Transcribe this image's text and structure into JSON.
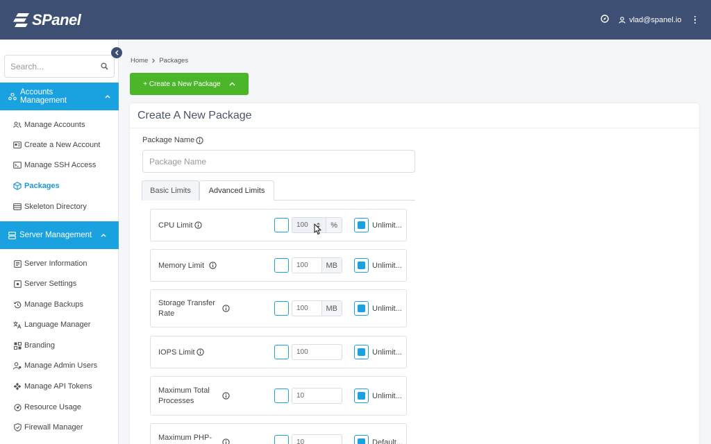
{
  "brand": {
    "name": "SPanel"
  },
  "topbar": {
    "user_email": "vlad@spanel.io"
  },
  "sidebar": {
    "search_placeholder": "Search...",
    "section_accounts": "Accounts Management",
    "accounts_items": [
      {
        "label": "Manage Accounts",
        "icon": "users-icon"
      },
      {
        "label": "Create a New Account",
        "icon": "id-card-icon"
      },
      {
        "label": "Manage SSH Access",
        "icon": "terminal-icon"
      },
      {
        "label": "Packages",
        "icon": "package-icon",
        "active": true
      },
      {
        "label": "Skeleton Directory",
        "icon": "folder-list-icon"
      }
    ],
    "section_server": "Server Management",
    "server_items": [
      {
        "label": "Server Information",
        "icon": "document-icon"
      },
      {
        "label": "Server Settings",
        "icon": "settings-icon"
      },
      {
        "label": "Manage Backups",
        "icon": "history-icon"
      },
      {
        "label": "Language Manager",
        "icon": "translate-icon"
      },
      {
        "label": "Branding",
        "icon": "branding-icon"
      },
      {
        "label": "Manage Admin Users",
        "icon": "admin-user-icon"
      },
      {
        "label": "Manage API Tokens",
        "icon": "api-icon"
      },
      {
        "label": "Resource Usage",
        "icon": "gauge-icon"
      },
      {
        "label": "Firewall Manager",
        "icon": "shield-icon"
      }
    ]
  },
  "breadcrumb": {
    "home": "Home",
    "current": "Packages"
  },
  "create_button": {
    "label": "+ Create a New Package"
  },
  "card": {
    "title": "Create A New Package",
    "package_name_label": "Package Name",
    "package_name_placeholder": "Package Name",
    "tabs": [
      {
        "label": "Basic Limits",
        "active": false
      },
      {
        "label": "Advanced Limits",
        "active": true
      }
    ]
  },
  "limits": [
    {
      "label": "CPU Limit",
      "value": "100",
      "unit": "%",
      "spinner": true,
      "toggle_label": "Unlimit..."
    },
    {
      "label": "Memory Limit",
      "value": "100",
      "unit": "MB",
      "toggle_label": "Unlimit..."
    },
    {
      "label_line1": "Storage Transfer",
      "label_line2": "Rate",
      "value": "100",
      "unit": "MB",
      "toggle_label": "Unlimit..."
    },
    {
      "label": "IOPS Limit",
      "value": "100",
      "unit": "",
      "toggle_label": "Unlimit..."
    },
    {
      "label_line1": "Maximum Total",
      "label_line2": "Processes",
      "value": "10",
      "unit": "",
      "toggle_label": "Unlimit..."
    },
    {
      "label_line1": "Maximum PHP-",
      "label_line2": "",
      "value": "10",
      "unit": "",
      "toggle_label": "Default..."
    }
  ],
  "colors": {
    "topbar": "#3e4f74",
    "accent": "#1aa1e0",
    "button_green": "#4cb62a"
  }
}
